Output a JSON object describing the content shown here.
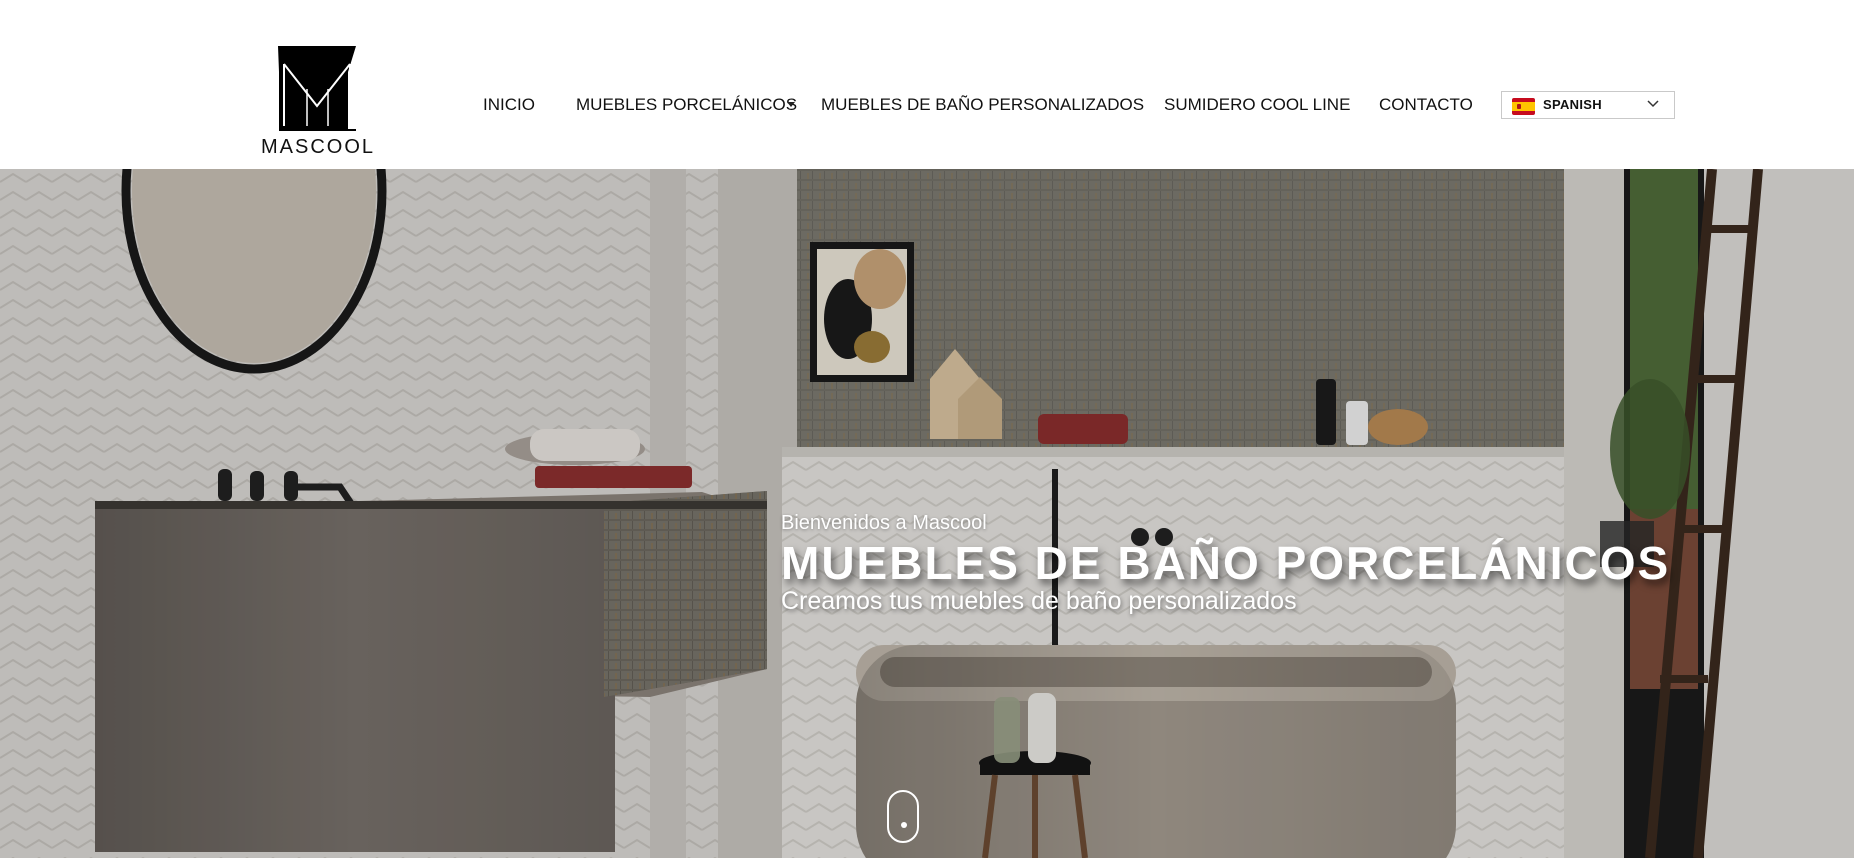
{
  "brand": {
    "logo_text": "MASCOOL",
    "logo_color": "#000000"
  },
  "nav": {
    "items": [
      {
        "label": "INICIO"
      },
      {
        "label": "MUEBLES PORCELÁNICOS",
        "has_dropdown": true
      },
      {
        "label": "MUEBLES DE BAÑO PERSONALIZADOS"
      },
      {
        "label": "SUMIDERO COOL LINE"
      },
      {
        "label": "CONTACTO"
      }
    ]
  },
  "language": {
    "selected": "SPANISH",
    "flag": "spain-flag-icon"
  },
  "hero": {
    "welcome": "Bienvenidos a Mascool",
    "headline": "MUEBLES DE BAÑO PORCELÁNICOS",
    "subline": "Creamos tus muebles de baño personalizados",
    "scroll_icon": "mouse-scroll-icon"
  },
  "colors": {
    "header_bg": "#ffffff",
    "text_dark": "#111111",
    "hero_text": "#ffffff"
  }
}
